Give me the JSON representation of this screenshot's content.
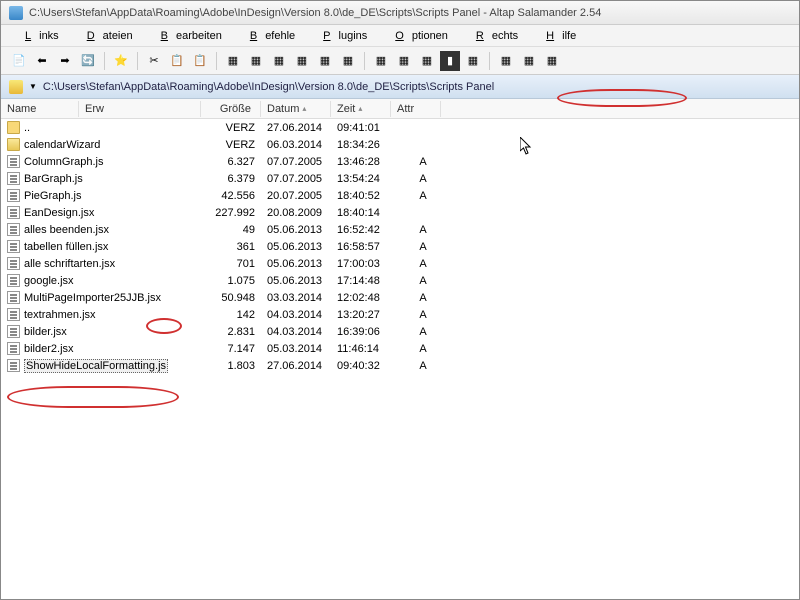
{
  "window": {
    "title": "C:\\Users\\Stefan\\AppData\\Roaming\\Adobe\\InDesign\\Version 8.0\\de_DE\\Scripts\\Scripts Panel - Altap Salamander 2.54"
  },
  "menu": {
    "items": [
      "Links",
      "Dateien",
      "Bearbeiten",
      "Befehle",
      "Plugins",
      "Optionen",
      "Rechts",
      "Hilfe"
    ]
  },
  "address": {
    "path": "C:\\Users\\Stefan\\AppData\\Roaming\\Adobe\\InDesign\\Version 8.0\\de_DE\\Scripts\\Scripts Panel"
  },
  "columns": {
    "name": "Name",
    "erw": "Erw",
    "size": "Größe",
    "date": "Datum",
    "time": "Zeit",
    "attr": "Attr"
  },
  "rows": [
    {
      "icon": "up",
      "name": "..",
      "size": "VERZ",
      "date": "27.06.2014",
      "time": "09:41:01",
      "attr": ""
    },
    {
      "icon": "folder",
      "name": "calendarWizard",
      "size": "VERZ",
      "date": "06.03.2014",
      "time": "18:34:26",
      "attr": ""
    },
    {
      "icon": "js",
      "name": "ColumnGraph.js",
      "size": "6.327",
      "date": "07.07.2005",
      "time": "13:46:28",
      "attr": "A"
    },
    {
      "icon": "js",
      "name": "BarGraph.js",
      "size": "6.379",
      "date": "07.07.2005",
      "time": "13:54:24",
      "attr": "A"
    },
    {
      "icon": "js",
      "name": "PieGraph.js",
      "size": "42.556",
      "date": "20.07.2005",
      "time": "18:40:52",
      "attr": "A"
    },
    {
      "icon": "js",
      "name": "EanDesign.jsx",
      "size": "227.992",
      "date": "20.08.2009",
      "time": "18:40:14",
      "attr": ""
    },
    {
      "icon": "js",
      "name": "alles beenden.jsx",
      "size": "49",
      "date": "05.06.2013",
      "time": "16:52:42",
      "attr": "A"
    },
    {
      "icon": "js",
      "name": "tabellen füllen.jsx",
      "size": "361",
      "date": "05.06.2013",
      "time": "16:58:57",
      "attr": "A"
    },
    {
      "icon": "js",
      "name": "alle schriftarten.jsx",
      "size": "701",
      "date": "05.06.2013",
      "time": "17:00:03",
      "attr": "A"
    },
    {
      "icon": "js",
      "name": "google.jsx",
      "size": "1.075",
      "date": "05.06.2013",
      "time": "17:14:48",
      "attr": "A"
    },
    {
      "icon": "js",
      "name": "MultiPageImporter25JJB.jsx",
      "size": "50.948",
      "date": "03.03.2014",
      "time": "12:02:48",
      "attr": "A"
    },
    {
      "icon": "js",
      "name": "textrahmen.jsx",
      "size": "142",
      "date": "04.03.2014",
      "time": "13:20:27",
      "attr": "A"
    },
    {
      "icon": "js",
      "name": "bilder.jsx",
      "size": "2.831",
      "date": "04.03.2014",
      "time": "16:39:06",
      "attr": "A"
    },
    {
      "icon": "js",
      "name": "bilder2.jsx",
      "size": "7.147",
      "date": "05.03.2014",
      "time": "11:46:14",
      "attr": "A"
    },
    {
      "icon": "js",
      "name": "ShowHideLocalFormatting.js",
      "size": "1.803",
      "date": "27.06.2014",
      "time": "09:40:32",
      "attr": "A",
      "selected": true
    }
  ]
}
